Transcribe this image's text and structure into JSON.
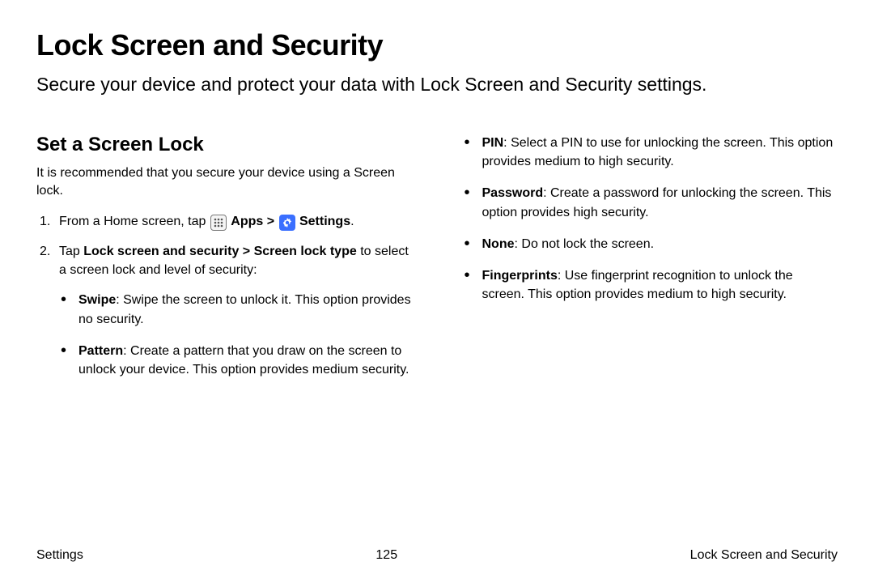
{
  "heading": "Lock Screen and Security",
  "intro": "Secure your device and protect your data with Lock Screen and Security settings.",
  "section_heading": "Set a Screen Lock",
  "recommendation": "It is recommended that you secure your device using a Screen lock.",
  "step1_pre": "From a Home screen, tap ",
  "step1_apps": "Apps",
  "step1_sep": " > ",
  "step1_settings": "Settings",
  "step1_post": ".",
  "step2_pre": "Tap ",
  "step2_bold": "Lock screen and security > Screen lock type",
  "step2_post": " to select a screen lock and level of security:",
  "swipe_label": "Swipe",
  "swipe_desc": ": Swipe the screen to unlock it. This option provides no security.",
  "pattern_label": "Pattern",
  "pattern_desc": ": Create a pattern that you draw on the screen to unlock your device. This option provides medium security.",
  "pin_label": "PIN",
  "pin_desc": ": Select a PIN to use for unlocking the screen. This option provides medium to high security.",
  "password_label": "Password",
  "password_desc": ": Create a password for unlocking the screen. This option provides high security.",
  "none_label": "None",
  "none_desc": ": Do not lock the screen.",
  "fingerprints_label": "Fingerprints",
  "fingerprints_desc": ": Use fingerprint recognition to unlock the screen. This option provides medium to high security.",
  "footer_left": "Settings",
  "footer_center": "125",
  "footer_right": "Lock Screen and Security"
}
